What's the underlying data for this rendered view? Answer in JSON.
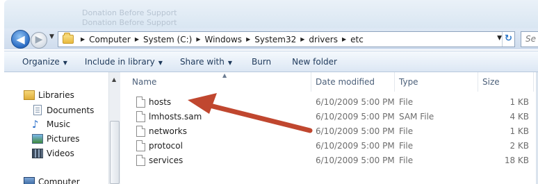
{
  "window": {
    "ghost_title_lines": [
      "Donation Before Support",
      "Donation Before Support"
    ]
  },
  "navigation": {
    "back_glyph": "◀",
    "forward_glyph": "▶",
    "recent_glyph": "▼",
    "breadcrumb": [
      "Computer",
      "System (C:)",
      "Windows",
      "System32",
      "drivers",
      "etc"
    ],
    "breadcrumb_sep": "▶",
    "dropdown_glyph": "▼",
    "refresh_glyph": "↻",
    "search_placeholder": "Se"
  },
  "command_bar": {
    "items": [
      {
        "label": "Organize",
        "has_dropdown": true
      },
      {
        "label": "Include in library",
        "has_dropdown": true
      },
      {
        "label": "Share with",
        "has_dropdown": true
      },
      {
        "label": "Burn",
        "has_dropdown": false
      },
      {
        "label": "New folder",
        "has_dropdown": false
      }
    ],
    "caret": "▼"
  },
  "nav_pane": {
    "items": [
      {
        "label": "Libraries",
        "icon": "libraries-icon"
      },
      {
        "label": "Documents",
        "icon": "documents-icon"
      },
      {
        "label": "Music",
        "icon": "music-icon"
      },
      {
        "label": "Pictures",
        "icon": "pictures-icon"
      },
      {
        "label": "Videos",
        "icon": "videos-icon"
      },
      {
        "label": "Computer",
        "icon": "computer-icon"
      }
    ],
    "music_glyph": "♪",
    "scroll_up_glyph": "▲"
  },
  "file_list": {
    "columns": [
      "Name",
      "Date modified",
      "Type",
      "Size"
    ],
    "sort_glyph": "▲",
    "rows": [
      {
        "name": "hosts",
        "date": "6/10/2009 5:00 PM",
        "type": "File",
        "size": "1 KB"
      },
      {
        "name": "lmhosts.sam",
        "date": "6/10/2009 5:00 PM",
        "type": "SAM File",
        "size": "4 KB"
      },
      {
        "name": "networks",
        "date": "6/10/2009 5:00 PM",
        "type": "File",
        "size": "1 KB"
      },
      {
        "name": "protocol",
        "date": "6/10/2009 5:00 PM",
        "type": "File",
        "size": "2 KB"
      },
      {
        "name": "services",
        "date": "6/10/2009 5:00 PM",
        "type": "File",
        "size": "18 KB"
      }
    ]
  },
  "annotation": {
    "color": "#c0472f",
    "points_to": "hosts"
  }
}
